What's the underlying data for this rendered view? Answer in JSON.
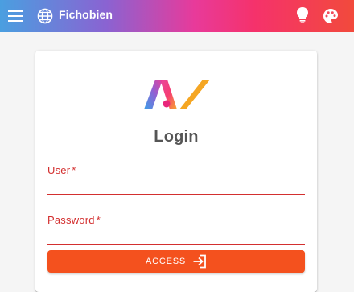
{
  "appbar": {
    "title": "Fichobien",
    "menu_icon": "menu-icon",
    "language_icon": "globe-icon",
    "theme_icon": "lightbulb-icon",
    "palette_icon": "palette-icon",
    "colors": {
      "gradient_start": "#4a9fe0",
      "gradient_mid": "#e83a9a",
      "gradient_end": "#f24a3c"
    }
  },
  "login": {
    "title": "Login",
    "fields": {
      "user": {
        "label": "User",
        "required_mark": "*",
        "value": ""
      },
      "password": {
        "label": "Password",
        "required_mark": "*",
        "value": ""
      }
    },
    "submit": {
      "label": "ACCESS",
      "icon": "login-icon"
    }
  },
  "colors": {
    "error": "#d32f2f",
    "accent": "#f4511e",
    "background": "#f5f5f5"
  }
}
